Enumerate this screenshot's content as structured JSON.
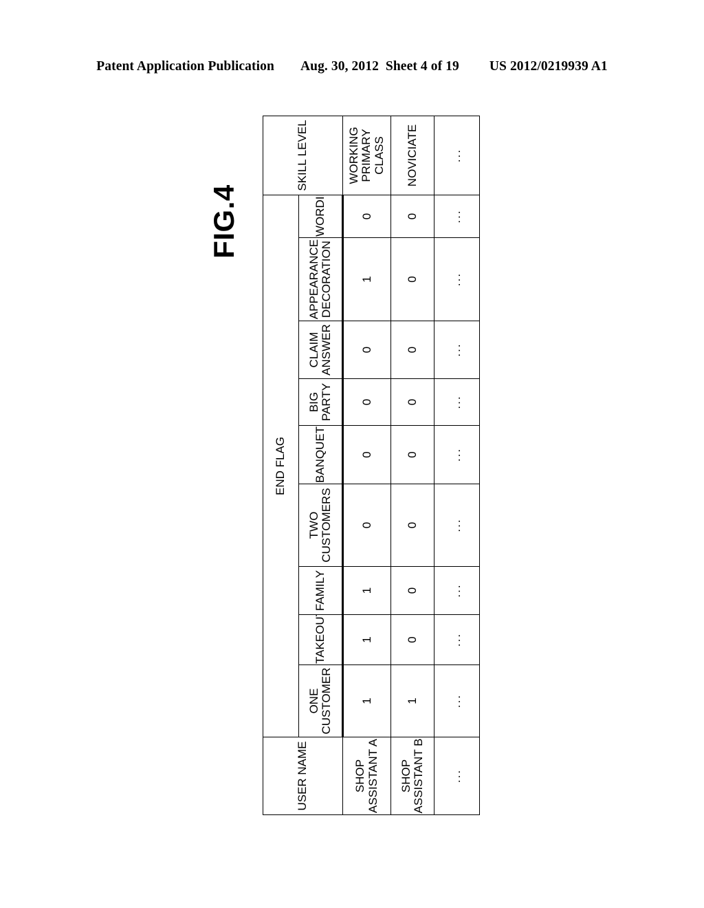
{
  "patent_header": {
    "publication": "Patent Application Publication",
    "date": "Aug. 30, 2012",
    "sheet": "Sheet 4 of 19",
    "number": "US 2012/0219939 A1"
  },
  "figure": {
    "label": "FIG.4"
  },
  "table": {
    "group_headers": {
      "user_name": "USER NAME",
      "end_flag": "END FLAG",
      "skill_level": "SKILL LEVEL"
    },
    "sub_headers": [
      "ONE CUSTOMER",
      "TAKEOUT",
      "FAMILY",
      "TWO CUSTOMERS",
      "BANQUET",
      "BIG PARTY",
      "CLAIM ANSWER",
      "APPEARANCE DECORATION",
      "WORDING"
    ],
    "rows": [
      {
        "user_name": "SHOP ASSISTANT A",
        "flags": [
          "1",
          "1",
          "1",
          "0",
          "0",
          "0",
          "0",
          "1",
          "0"
        ],
        "skill_level": "WORKING PRIMARY CLASS"
      },
      {
        "user_name": "SHOP ASSISTANT B",
        "flags": [
          "1",
          "0",
          "0",
          "0",
          "0",
          "0",
          "0",
          "0",
          "0"
        ],
        "skill_level": "NOVICIATE"
      },
      {
        "user_name": "...",
        "flags": [
          "...",
          "...",
          "...",
          "...",
          "...",
          "...",
          "...",
          "...",
          "..."
        ],
        "skill_level": "..."
      }
    ]
  }
}
